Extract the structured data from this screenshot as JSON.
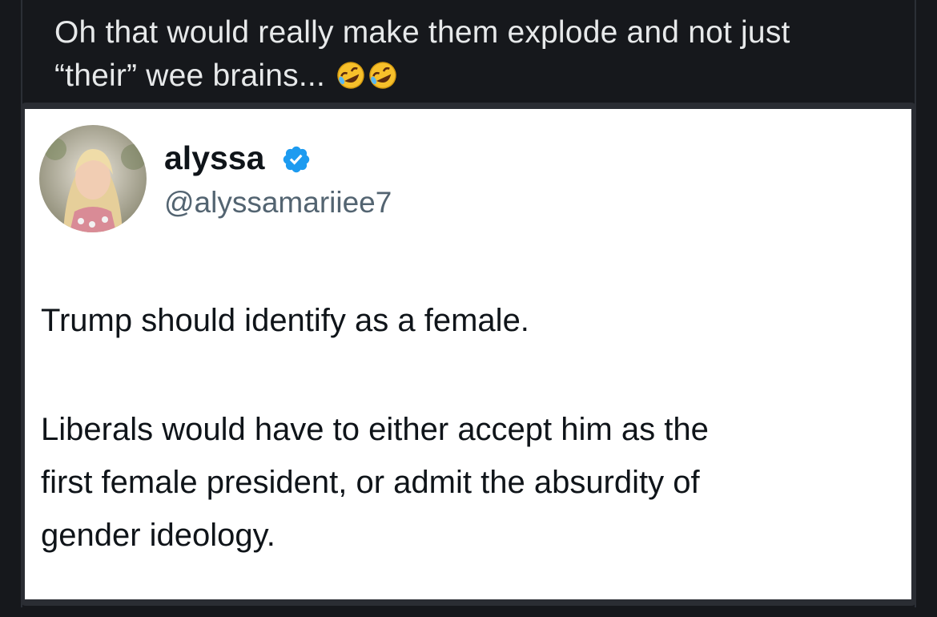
{
  "post": {
    "line1": "Oh that would really make them explode and not just",
    "line2": "“their” wee brains...",
    "emoji": [
      "rolling-on-floor-laughing-icon",
      "rolling-on-floor-laughing-icon"
    ]
  },
  "quoted_tweet": {
    "display_name": "alyssa",
    "handle": "@alyssamariiee7",
    "verified": true,
    "text_lines": [
      "Trump should identify as a female.",
      "Liberals would have to either accept him as the",
      "first female president, or admit the absurdity of",
      "gender ideology."
    ]
  },
  "colors": {
    "background": "#16181c",
    "text": "#e7e9ea",
    "card_background": "#ffffff",
    "handle_gray": "#536471",
    "verified_blue": "#1d9bf0"
  }
}
